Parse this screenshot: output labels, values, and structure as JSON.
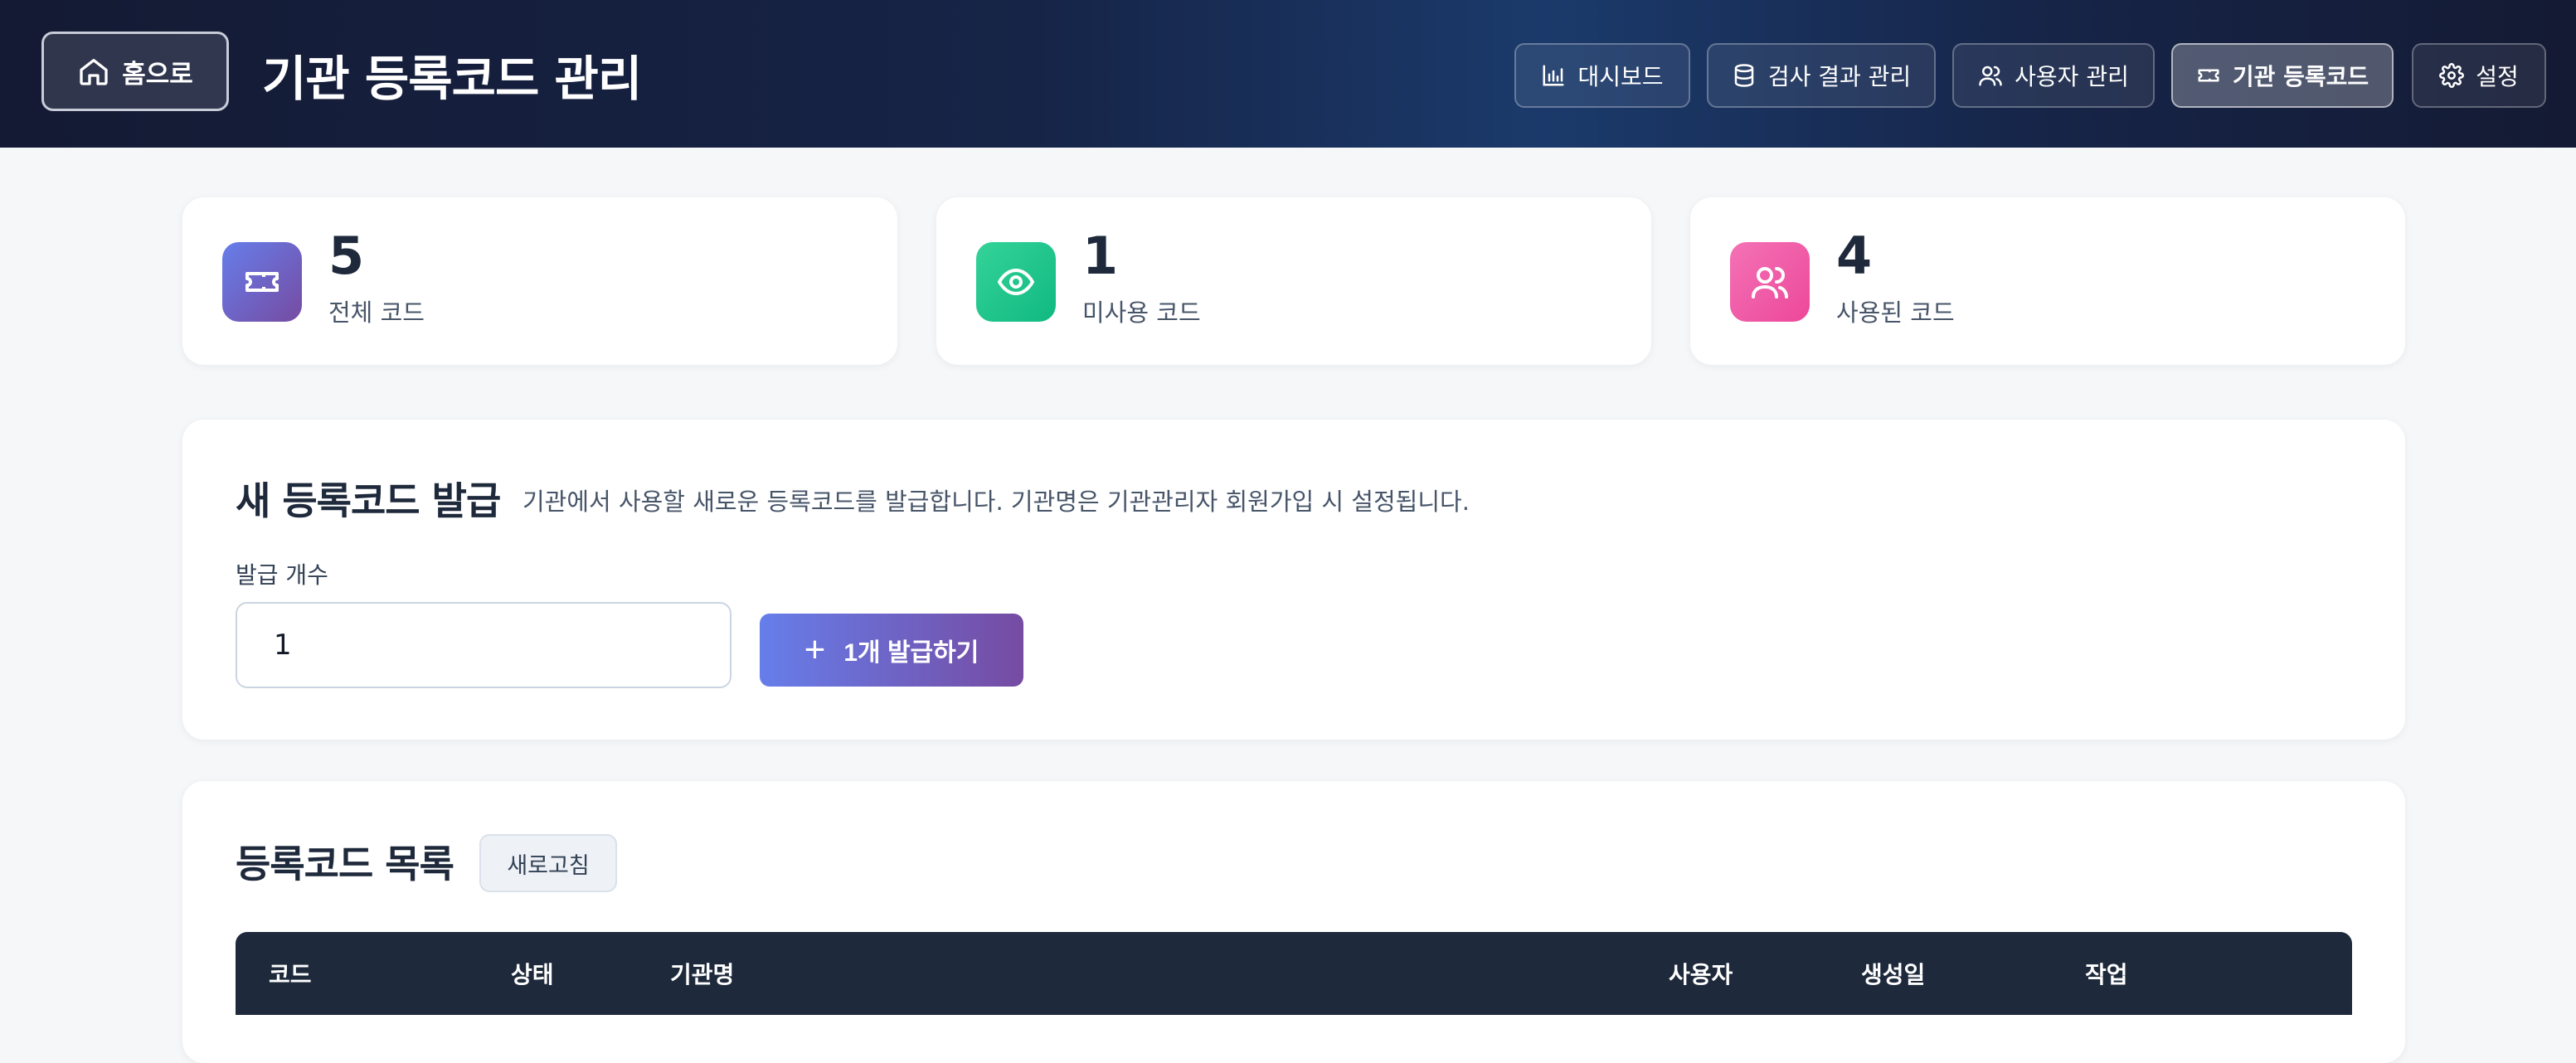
{
  "header": {
    "home_label": "홈으로",
    "title": "기관 등록코드 관리",
    "nav": [
      {
        "label": "대시보드",
        "icon": "bar-chart-icon"
      },
      {
        "label": "검사 결과 관리",
        "icon": "database-icon"
      },
      {
        "label": "사용자 관리",
        "icon": "users-icon"
      },
      {
        "label": "기관 등록코드",
        "icon": "ticket-icon",
        "active": true
      },
      {
        "label": "설정",
        "icon": "gear-icon"
      }
    ]
  },
  "stats": [
    {
      "value": "5",
      "label": "전체 코드",
      "icon": "ticket-icon",
      "color": "#667eea"
    },
    {
      "value": "1",
      "label": "미사용 코드",
      "icon": "eye-icon",
      "color": "#10b981"
    },
    {
      "value": "4",
      "label": "사용된 코드",
      "icon": "users-icon",
      "color": "#ec4899"
    }
  ],
  "issue": {
    "title": "새 등록코드 발급",
    "description": "기관에서 사용할 새로운 등록코드를 발급합니다. 기관명은 기관관리자 회원가입 시 설정됩니다.",
    "quantity_label": "발급 개수",
    "quantity_value": "1",
    "button_label": "1개 발급하기",
    "button_icon": "plus-icon"
  },
  "list": {
    "title": "등록코드 목록",
    "refresh_label": "새로고침",
    "columns": [
      "코드",
      "상태",
      "기관명",
      "사용자",
      "생성일",
      "작업"
    ]
  },
  "colors": {
    "accent_start": "#667eea",
    "accent_end": "#764ba2",
    "header_bg": "#162447",
    "table_head_bg": "#1e293b"
  }
}
